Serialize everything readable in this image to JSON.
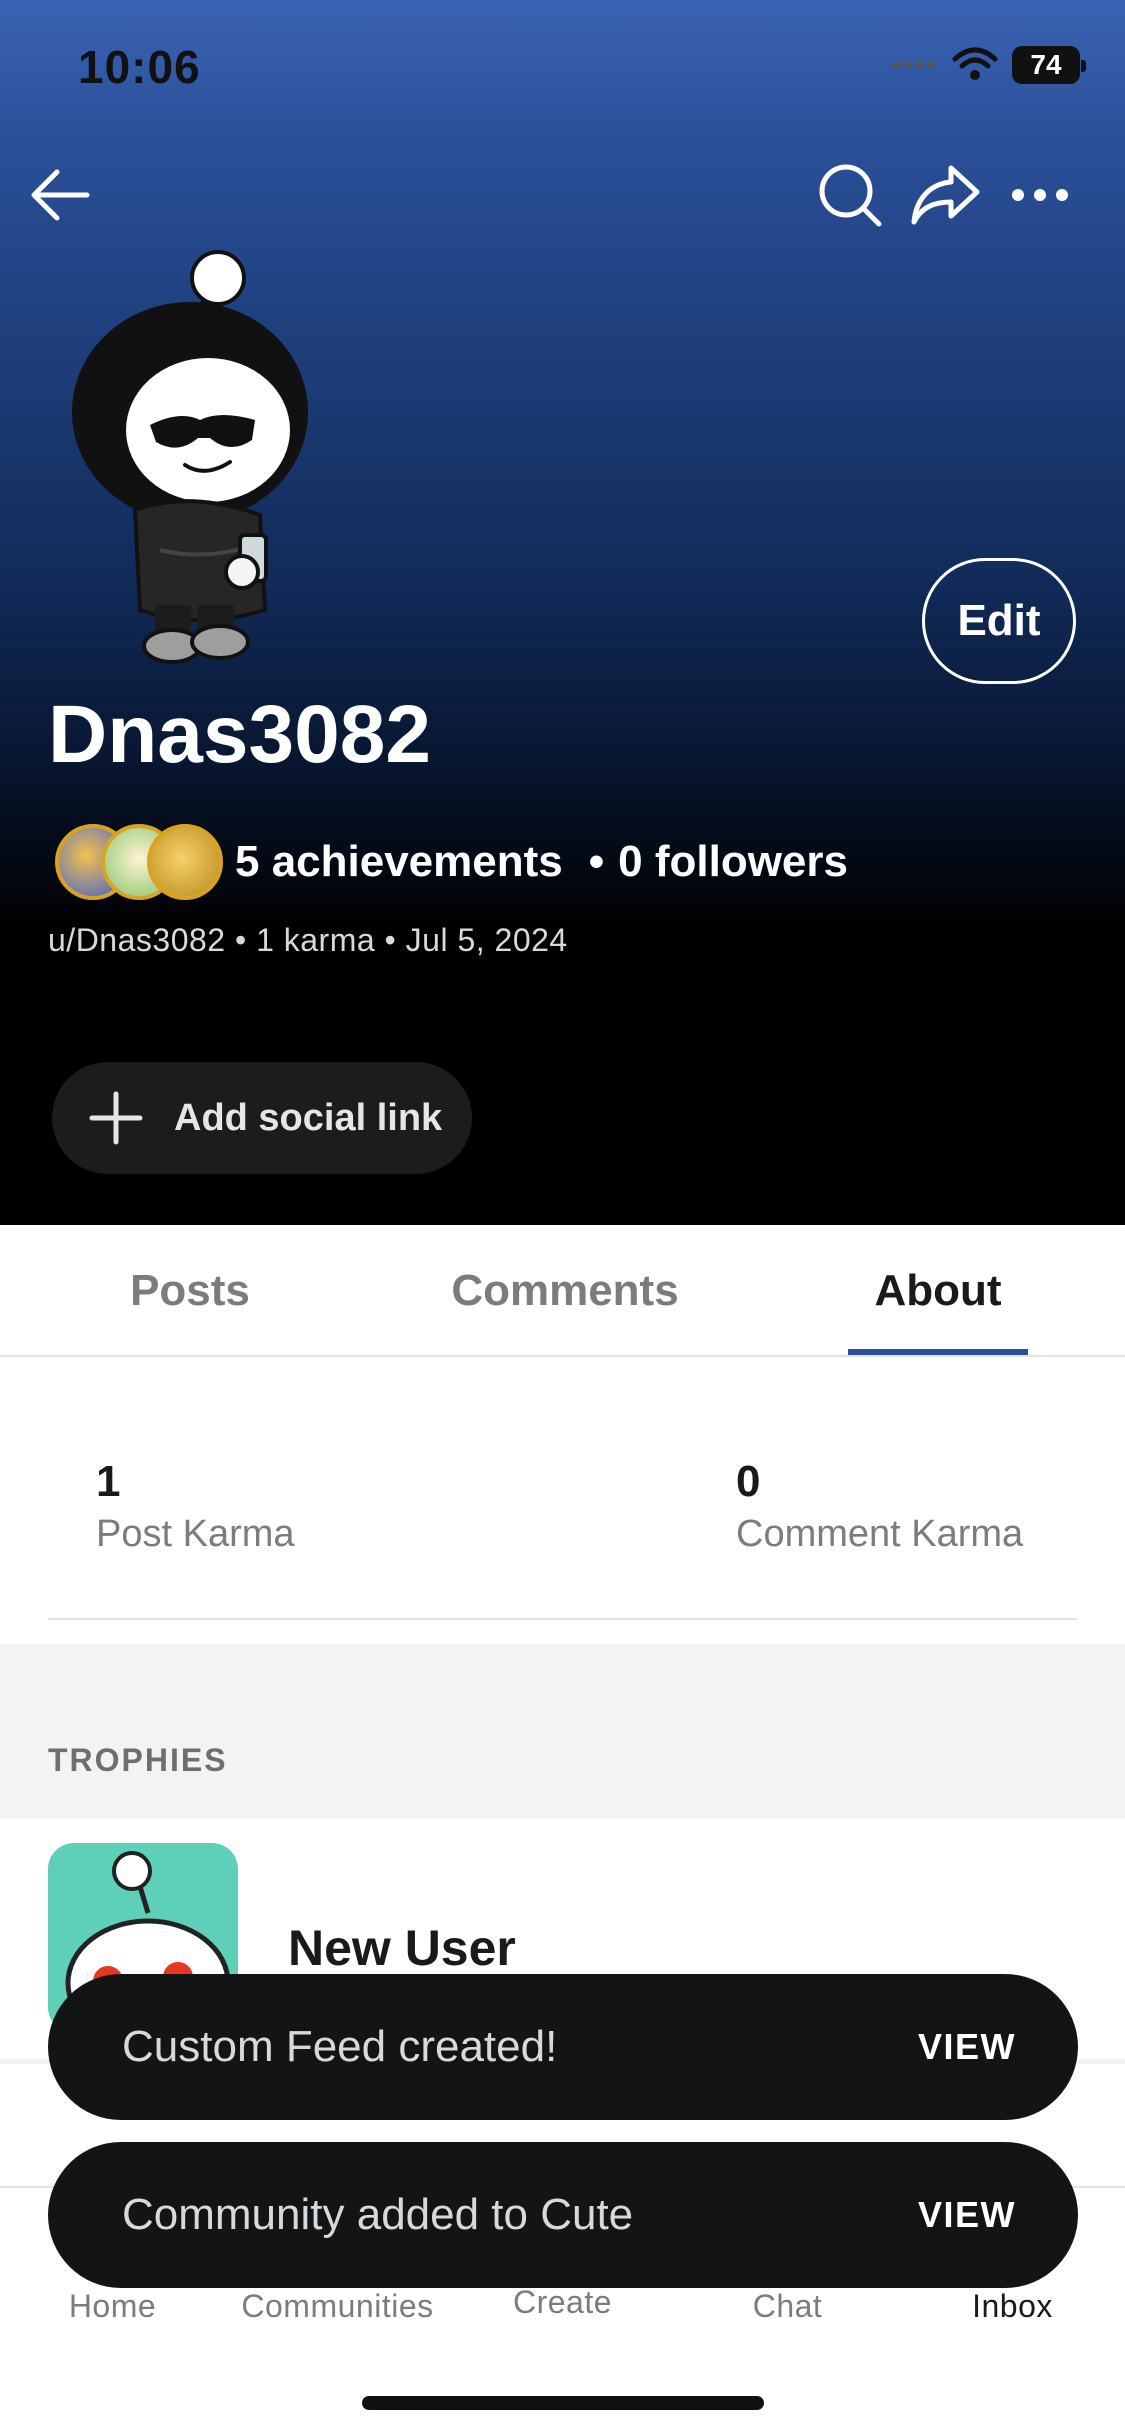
{
  "status_bar": {
    "time": "10:06",
    "battery": "74"
  },
  "header": {
    "back_icon": "arrow-left-icon",
    "search_icon": "search-icon",
    "share_icon": "share-icon",
    "more_icon": "more-horizontal-icon"
  },
  "profile": {
    "display_name": "Dnas3082",
    "edit_label": "Edit",
    "achievements": "5 achievements",
    "followers": "0 followers",
    "handle": "u/Dnas3082",
    "karma": "1 karma",
    "joined": "Jul 5, 2024",
    "add_social_label": "Add social link"
  },
  "tabs": [
    {
      "label": "Posts",
      "active": false
    },
    {
      "label": "Comments",
      "active": false
    },
    {
      "label": "About",
      "active": true
    }
  ],
  "about": {
    "post_karma_value": "1",
    "post_karma_label": "Post Karma",
    "comment_karma_value": "0",
    "comment_karma_label": "Comment Karma"
  },
  "trophies": {
    "title": "TROPHIES",
    "items": [
      {
        "name": "New User"
      }
    ]
  },
  "toasts": [
    {
      "message": "Custom Feed created!",
      "action": "VIEW"
    },
    {
      "message": "Community added to Cute",
      "action": "VIEW"
    }
  ],
  "bottom_nav": {
    "home": "Home",
    "communities": "Communities",
    "create": "Create",
    "chat": "Chat",
    "inbox": "Inbox"
  },
  "colors": {
    "accent": "#2a4f98",
    "toast_bg": "#131416",
    "trophy_bg": "#5ecfb9"
  }
}
